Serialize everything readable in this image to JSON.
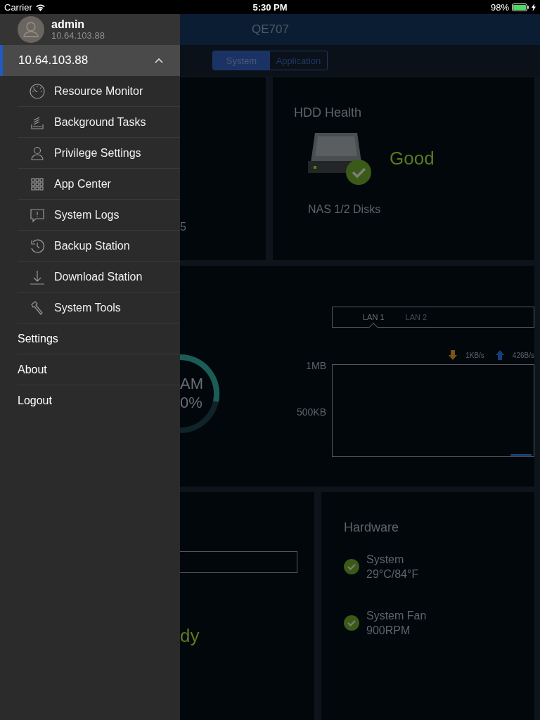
{
  "status_bar": {
    "carrier": "Carrier",
    "time": "5:30 PM",
    "battery": "98%"
  },
  "drawer": {
    "user": {
      "name": "admin",
      "address": "10.64.103.88"
    },
    "server": {
      "label": "10.64.103.88",
      "selected": true,
      "expanded": true
    },
    "items": [
      {
        "label": "Resource Monitor"
      },
      {
        "label": "Background Tasks"
      },
      {
        "label": "Privilege Settings"
      },
      {
        "label": "App Center"
      },
      {
        "label": "System Logs"
      },
      {
        "label": "Backup Station"
      },
      {
        "label": "Download Station"
      },
      {
        "label": "System Tools"
      }
    ],
    "bottom_items": [
      {
        "label": "Settings"
      },
      {
        "label": "About"
      },
      {
        "label": "Logout"
      }
    ]
  },
  "main": {
    "title": "QE707",
    "segments": [
      {
        "label": "System",
        "selected": true
      },
      {
        "label": "Application",
        "selected": false
      }
    ],
    "left_card_fragment": {
      "text": "5"
    },
    "hdd_health": {
      "title": "HDD Health",
      "status": "Good",
      "disks": "NAS 1/2 Disks"
    },
    "ram_fragment": {
      "line_1": "AM",
      "line_2": "0%"
    },
    "network": {
      "lan_tabs": [
        {
          "label": "LAN 1",
          "selected": true
        },
        {
          "label": "LAN 2",
          "selected": false
        }
      ],
      "download": "1KB/s",
      "upload": "426B/s",
      "y_labels": [
        "1MB",
        "500KB"
      ]
    },
    "bottom_left_fragment": {
      "text": "dy"
    },
    "hardware": {
      "title": "Hardware",
      "items": [
        {
          "name": "System",
          "reading": "29°C/84°F"
        },
        {
          "name": "System Fan",
          "reading": "900RPM"
        }
      ]
    }
  }
}
